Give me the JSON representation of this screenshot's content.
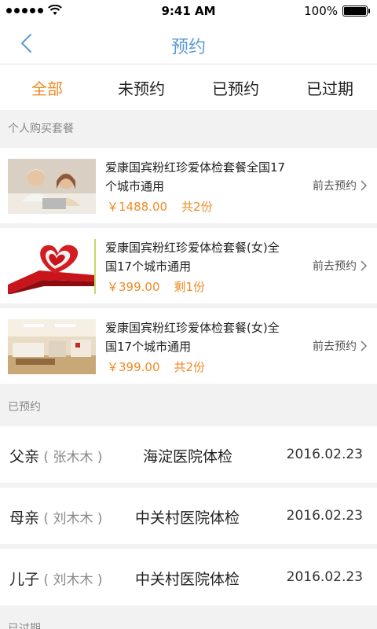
{
  "status": {
    "time": "9:41 AM",
    "battery": "100%",
    "battery_level": 1.0,
    "signal_dots": 5
  },
  "nav": {
    "title": "预约",
    "back_icon": "chevron-left-icon"
  },
  "tabs": [
    {
      "label": "全部",
      "active": true
    },
    {
      "label": "未预约",
      "active": false
    },
    {
      "label": "已预约",
      "active": false
    },
    {
      "label": "已过期",
      "active": false
    }
  ],
  "sections": {
    "purchased": "个人购买套餐",
    "booked": "已预约",
    "expired": "已过期"
  },
  "packages": [
    {
      "title": "爱康国宾粉红珍爱体检套餐全国17个城市通用",
      "price": "￥1488.00",
      "qty": "共2份",
      "action": "前去预约",
      "image": "elderly-couple-photo"
    },
    {
      "title": "爱康国宾粉红珍爱体检套餐(女)全国17个城市通用",
      "price": "￥399.00",
      "qty": "剩1份",
      "action": "前去预约",
      "image": "red-heart-ribbon"
    },
    {
      "title": "爱康国宾粉红珍爱体检套餐(女)全国17个城市通用",
      "price": "￥399.00",
      "qty": "共2份",
      "action": "前去预约",
      "image": "clinic-lobby-photo"
    }
  ],
  "booked": [
    {
      "relation": "父亲",
      "name": "张木木",
      "hospital": "海淀医院体检",
      "date": "2016.02.23"
    },
    {
      "relation": "母亲",
      "name": "刘木木",
      "hospital": "中关村医院体检",
      "date": "2016.02.23"
    },
    {
      "relation": "儿子",
      "name": "刘木木",
      "hospital": "中关村医院体检",
      "date": "2016.02.23"
    }
  ],
  "colors": {
    "accent": "#f08a24",
    "nav_title": "#5b9bd5"
  }
}
